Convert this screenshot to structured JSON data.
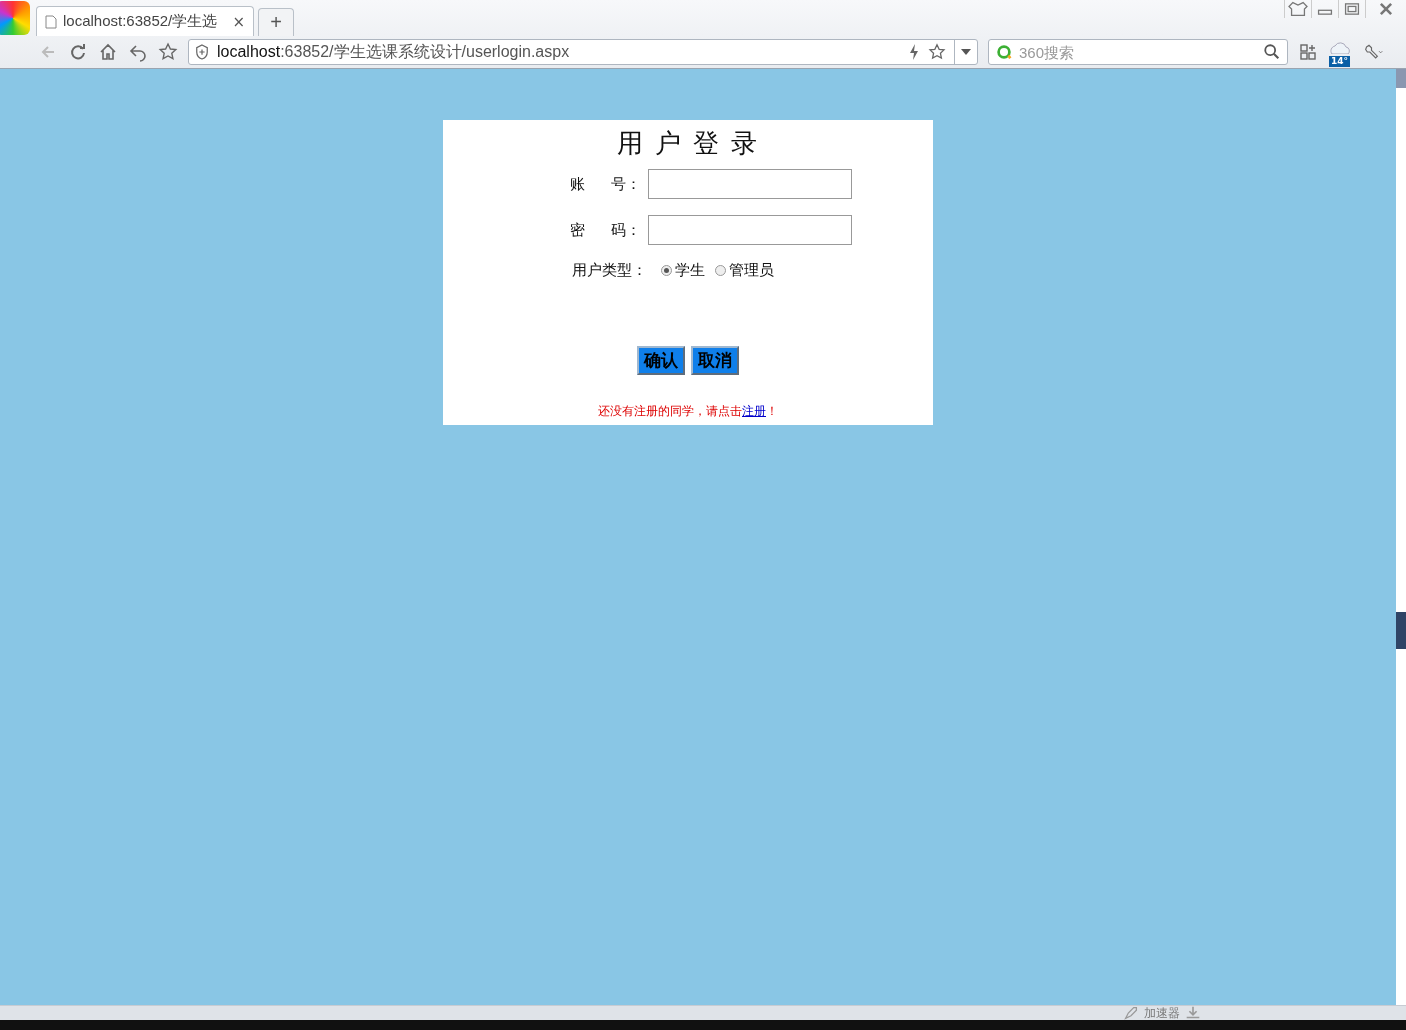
{
  "browser": {
    "tab": {
      "title": "localhost:63852/学生选",
      "close": "×",
      "selected": true
    },
    "new_tab": "+",
    "address": {
      "host": "localhost",
      "path": ":63852/学生选课系统设计/userlogin.aspx"
    },
    "search": {
      "placeholder": "360搜索"
    },
    "weather": "14°"
  },
  "login": {
    "title": "用 户 登 录",
    "fields": [
      {
        "label": "账",
        "label_end": "号："
      },
      {
        "label": "密",
        "label_end": "码："
      }
    ],
    "user_type": {
      "label": "用户类型：",
      "options": [
        {
          "label": "学生",
          "selected": true
        },
        {
          "label": "管理员",
          "selected": false
        }
      ]
    },
    "buttons": [
      "确认",
      "取消"
    ],
    "note": {
      "text": "还没有注册的同学，请点击",
      "link": "注册",
      "end": "！"
    }
  },
  "status_bar": {
    "accelerator": "加速器"
  }
}
